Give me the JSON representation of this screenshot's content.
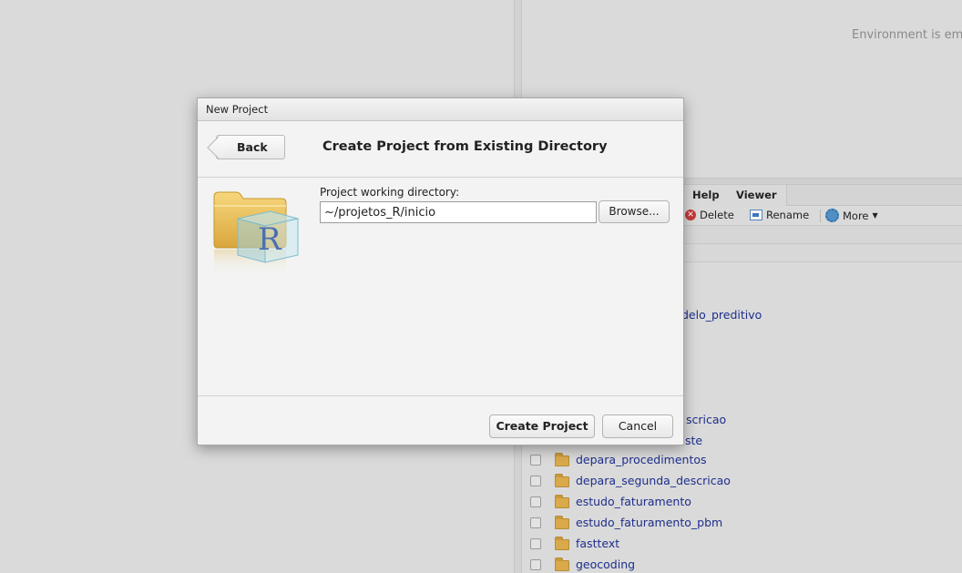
{
  "environment": {
    "empty_text": "Environment is emp"
  },
  "files_pane": {
    "tabs": [
      "Help",
      "Viewer"
    ],
    "toolbar": {
      "delete_label": "Delete",
      "rename_label": "Rename",
      "more_label": "More"
    },
    "partial_items": [
      "delo_preditivo",
      "scricao",
      "ste"
    ],
    "items": [
      "depara_procedimentos",
      "depara_segunda_descricao",
      "estudo_faturamento",
      "estudo_faturamento_pbm",
      "fasttext",
      "geocoding"
    ]
  },
  "dialog": {
    "title": "New Project",
    "back_label": "Back",
    "heading": "Create Project from Existing Directory",
    "dir_label": "Project working directory:",
    "dir_value": "~/projetos_R/inicio",
    "browse_label": "Browse...",
    "create_label": "Create Project",
    "cancel_label": "Cancel",
    "icon_letter": "R"
  }
}
